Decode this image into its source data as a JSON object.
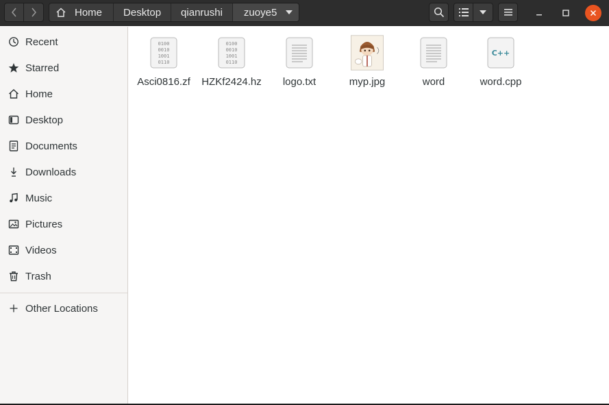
{
  "header": {
    "breadcrumbs": [
      "Home",
      "Desktop",
      "qianrushi",
      "zuoye5"
    ],
    "icons": {
      "back": "chevron-left-icon",
      "forward": "chevron-right-icon",
      "home": "home-icon",
      "dropdown": "chevron-down-icon",
      "search": "search-icon",
      "view": "list-view-icon",
      "menu": "hamburger-menu-icon",
      "minimize": "minimize-icon",
      "maximize": "maximize-icon",
      "close": "close-icon"
    },
    "close_color": "#e95420"
  },
  "sidebar": {
    "items": [
      {
        "label": "Recent",
        "icon": "clock-icon"
      },
      {
        "label": "Starred",
        "icon": "star-icon"
      },
      {
        "label": "Home",
        "icon": "home-icon"
      },
      {
        "label": "Desktop",
        "icon": "desktop-icon"
      },
      {
        "label": "Documents",
        "icon": "document-icon"
      },
      {
        "label": "Downloads",
        "icon": "download-icon"
      },
      {
        "label": "Music",
        "icon": "music-icon"
      },
      {
        "label": "Pictures",
        "icon": "pictures-icon"
      },
      {
        "label": "Videos",
        "icon": "video-icon"
      },
      {
        "label": "Trash",
        "icon": "trash-icon"
      }
    ],
    "other_locations": {
      "label": "Other Locations",
      "icon": "plus-icon"
    }
  },
  "files": [
    {
      "name": "Asci0816.zf",
      "type": "binary"
    },
    {
      "name": "HZKf2424.hz",
      "type": "binary"
    },
    {
      "name": "logo.txt",
      "type": "text"
    },
    {
      "name": "myp.jpg",
      "type": "image"
    },
    {
      "name": "word",
      "type": "text"
    },
    {
      "name": "word.cpp",
      "type": "cpp",
      "badge": "C++"
    }
  ]
}
